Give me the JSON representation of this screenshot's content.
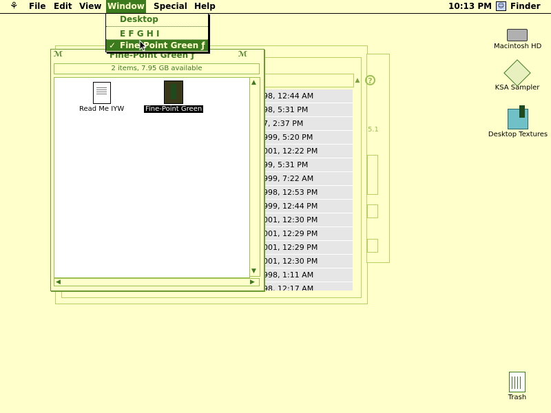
{
  "menubar": {
    "items": [
      {
        "label": "File"
      },
      {
        "label": "Edit"
      },
      {
        "label": "View"
      },
      {
        "label": "Window"
      },
      {
        "label": "Special"
      },
      {
        "label": "Help"
      }
    ],
    "active_index": 3,
    "clock": "10:13 PM",
    "app_name": "Finder"
  },
  "window_menu": {
    "items": [
      {
        "label": "Desktop",
        "checked": false
      },
      {
        "label": "E F G H I",
        "checked": false
      },
      {
        "label": "Fine-Point Green ƒ",
        "checked": true
      }
    ],
    "check_mark": "✓"
  },
  "front_window": {
    "title": "Fine-Point Green ƒ",
    "info": "2 items, 7.95 GB available",
    "files": [
      {
        "name": "Read Me IYW",
        "selected": false,
        "icon": "document-icon"
      },
      {
        "name": "Fine-Point Green",
        "selected": true,
        "icon": "pen-application-icon"
      }
    ]
  },
  "back_window": {
    "version_fragment": "5.1",
    "dates": [
      "98, 12:44 AM",
      "98, 5:31 PM",
      "7, 2:37 PM",
      "999, 5:20 PM",
      "001, 12:22 PM",
      "99, 5:31 PM",
      "999, 7:22 AM",
      "998, 12:53 PM",
      "999, 12:44 PM",
      "001, 12:30 PM",
      "001, 12:29 PM",
      "001, 12:29 PM",
      "001, 12:30 PM",
      "998, 1:11 AM",
      "98, 12:17 AM"
    ]
  },
  "desktop_icons": [
    {
      "label": "Macintosh HD",
      "icon": "hard-disk-icon"
    },
    {
      "label": "KSA Sampler",
      "icon": "ksa-sampler-icon"
    },
    {
      "label": "Desktop Textures",
      "icon": "desktop-textures-icon"
    },
    {
      "label": "Trash",
      "icon": "trash-icon"
    }
  ],
  "colors": {
    "desktop": "#ffffcc",
    "accent": "#3c7a1e",
    "window_border": "#9cc050"
  }
}
